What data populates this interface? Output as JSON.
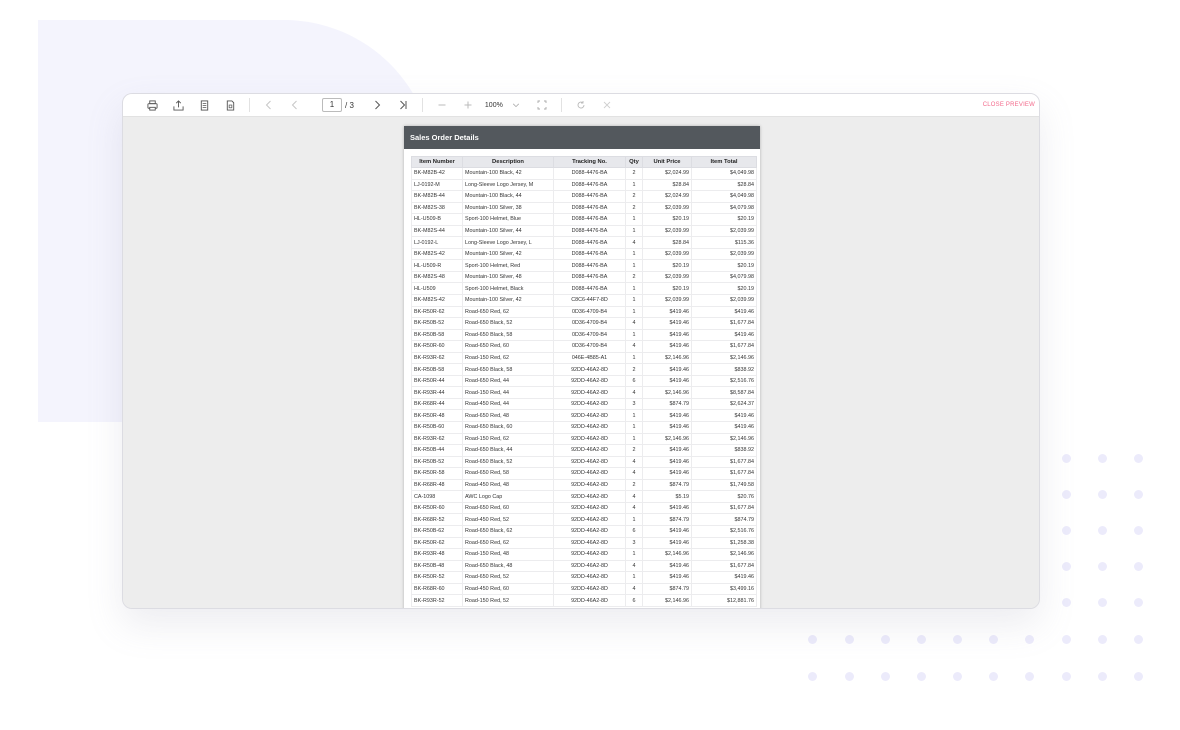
{
  "toolbar": {
    "current_page": "1",
    "page_total": "/ 3",
    "zoom": "100%",
    "close_label": "CLOSE PREVIEW"
  },
  "report": {
    "title": "Sales Order Details",
    "columns": [
      "Item Number",
      "Description",
      "Tracking No.",
      "Qty",
      "Unit Price",
      "Item Total"
    ],
    "rows": [
      [
        "BK-M82B-42",
        "Mountain-100 Black, 42",
        "D088-4476-BA",
        "2",
        "$2,024.99",
        "$4,049.98"
      ],
      [
        "LJ-0192-M",
        "Long-Sleeve Logo Jersey, M",
        "D088-4476-BA",
        "1",
        "$28.84",
        "$28.84"
      ],
      [
        "BK-M82B-44",
        "Mountain-100 Black, 44",
        "D088-4476-BA",
        "2",
        "$2,024.99",
        "$4,049.98"
      ],
      [
        "BK-M82S-38",
        "Mountain-100 Silver, 38",
        "D088-4476-BA",
        "2",
        "$2,039.99",
        "$4,079.98"
      ],
      [
        "HL-U509-B",
        "Sport-100 Helmet, Blue",
        "D088-4476-BA",
        "1",
        "$20.19",
        "$20.19"
      ],
      [
        "BK-M82S-44",
        "Mountain-100 Silver, 44",
        "D088-4476-BA",
        "1",
        "$2,039.99",
        "$2,039.99"
      ],
      [
        "LJ-0192-L",
        "Long-Sleeve Logo Jersey, L",
        "D088-4476-BA",
        "4",
        "$28.84",
        "$115.36"
      ],
      [
        "BK-M82S-42",
        "Mountain-100 Silver, 42",
        "D088-4476-BA",
        "1",
        "$2,039.99",
        "$2,039.99"
      ],
      [
        "HL-U509-R",
        "Sport-100 Helmet, Red",
        "D088-4476-BA",
        "1",
        "$20.19",
        "$20.19"
      ],
      [
        "BK-M82S-48",
        "Mountain-100 Silver, 48",
        "D088-4476-BA",
        "2",
        "$2,039.99",
        "$4,079.98"
      ],
      [
        "HL-U509",
        "Sport-100 Helmet, Black",
        "D088-4476-BA",
        "1",
        "$20.19",
        "$20.19"
      ],
      [
        "BK-M82S-42",
        "Mountain-100 Silver, 42",
        "C8C6-44F7-8D",
        "1",
        "$2,039.99",
        "$2,039.99"
      ],
      [
        "BK-R50R-62",
        "Road-650 Red, 62",
        "0D36-4709-B4",
        "1",
        "$419.46",
        "$419.46"
      ],
      [
        "BK-R50B-52",
        "Road-650 Black, 52",
        "0D36-4709-B4",
        "4",
        "$419.46",
        "$1,677.84"
      ],
      [
        "BK-R50B-58",
        "Road-650 Black, 58",
        "0D36-4709-B4",
        "1",
        "$419.46",
        "$419.46"
      ],
      [
        "BK-R50R-60",
        "Road-650 Red, 60",
        "0D36-4709-B4",
        "4",
        "$419.46",
        "$1,677.84"
      ],
      [
        "BK-R93R-62",
        "Road-150 Red, 62",
        "046E-4B85-A1",
        "1",
        "$2,146.96",
        "$2,146.96"
      ],
      [
        "BK-R50B-58",
        "Road-650 Black, 58",
        "92DD-46A2-8D",
        "2",
        "$419.46",
        "$838.92"
      ],
      [
        "BK-R50R-44",
        "Road-650 Red, 44",
        "92DD-46A2-8D",
        "6",
        "$419.46",
        "$2,516.76"
      ],
      [
        "BK-R93R-44",
        "Road-150 Red, 44",
        "92DD-46A2-8D",
        "4",
        "$2,146.96",
        "$8,587.84"
      ],
      [
        "BK-R68R-44",
        "Road-450 Red, 44",
        "92DD-46A2-8D",
        "3",
        "$874.79",
        "$2,624.37"
      ],
      [
        "BK-R50R-48",
        "Road-650 Red, 48",
        "92DD-46A2-8D",
        "1",
        "$419.46",
        "$419.46"
      ],
      [
        "BK-R50B-60",
        "Road-650 Black, 60",
        "92DD-46A2-8D",
        "1",
        "$419.46",
        "$419.46"
      ],
      [
        "BK-R93R-62",
        "Road-150 Red, 62",
        "92DD-46A2-8D",
        "1",
        "$2,146.96",
        "$2,146.96"
      ],
      [
        "BK-R50B-44",
        "Road-650 Black, 44",
        "92DD-46A2-8D",
        "2",
        "$419.46",
        "$838.92"
      ],
      [
        "BK-R50B-52",
        "Road-650 Black, 52",
        "92DD-46A2-8D",
        "4",
        "$419.46",
        "$1,677.84"
      ],
      [
        "BK-R50R-58",
        "Road-650 Red, 58",
        "92DD-46A2-8D",
        "4",
        "$419.46",
        "$1,677.84"
      ],
      [
        "BK-R68R-48",
        "Road-450 Red, 48",
        "92DD-46A2-8D",
        "2",
        "$874.79",
        "$1,749.58"
      ],
      [
        "CA-1098",
        "AWC Logo Cap",
        "92DD-46A2-8D",
        "4",
        "$5.19",
        "$20.76"
      ],
      [
        "BK-R50R-60",
        "Road-650 Red, 60",
        "92DD-46A2-8D",
        "4",
        "$419.46",
        "$1,677.84"
      ],
      [
        "BK-R68R-52",
        "Road-450 Red, 52",
        "92DD-46A2-8D",
        "1",
        "$874.79",
        "$874.79"
      ],
      [
        "BK-R50B-62",
        "Road-650 Black, 62",
        "92DD-46A2-8D",
        "6",
        "$419.46",
        "$2,516.76"
      ],
      [
        "BK-R50R-62",
        "Road-650 Red, 62",
        "92DD-46A2-8D",
        "3",
        "$419.46",
        "$1,258.38"
      ],
      [
        "BK-R93R-48",
        "Road-150 Red, 48",
        "92DD-46A2-8D",
        "1",
        "$2,146.96",
        "$2,146.96"
      ],
      [
        "BK-R50B-48",
        "Road-650 Black, 48",
        "92DD-46A2-8D",
        "4",
        "$419.46",
        "$1,677.84"
      ],
      [
        "BK-R50R-52",
        "Road-650 Red, 52",
        "92DD-46A2-8D",
        "1",
        "$419.46",
        "$419.46"
      ],
      [
        "BK-R68R-60",
        "Road-450 Red, 60",
        "92DD-46A2-8D",
        "4",
        "$874.79",
        "$3,499.16"
      ],
      [
        "BK-R93R-52",
        "Road-150 Red, 52",
        "92DD-46A2-8D",
        "6",
        "$2,146.96",
        "$12,881.76"
      ]
    ]
  }
}
